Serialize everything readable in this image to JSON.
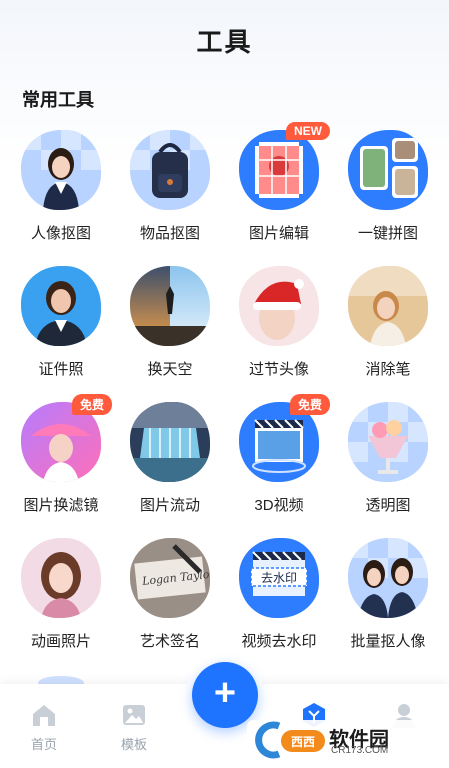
{
  "header": {
    "title": "工具"
  },
  "section": {
    "title": "常用工具"
  },
  "tools": [
    {
      "label": "人像抠图",
      "badge": ""
    },
    {
      "label": "物品抠图",
      "badge": ""
    },
    {
      "label": "图片编辑",
      "badge": "NEW"
    },
    {
      "label": "一键拼图",
      "badge": ""
    },
    {
      "label": "证件照",
      "badge": ""
    },
    {
      "label": "换天空",
      "badge": ""
    },
    {
      "label": "过节头像",
      "badge": ""
    },
    {
      "label": "消除笔",
      "badge": ""
    },
    {
      "label": "图片换滤镜",
      "badge": "免费"
    },
    {
      "label": "图片流动",
      "badge": ""
    },
    {
      "label": "3D视频",
      "badge": "免费"
    },
    {
      "label": "透明图",
      "badge": ""
    },
    {
      "label": "动画照片",
      "badge": ""
    },
    {
      "label": "艺术签名",
      "badge": ""
    },
    {
      "label": "视频去水印",
      "badge": ""
    },
    {
      "label": "批量抠人像",
      "badge": ""
    }
  ],
  "tool_images": {
    "art_signature_text": "Logan Taylor",
    "watermark_removal_text": "去水印"
  },
  "tabbar": {
    "home_label": "首页",
    "templates_label": "模板",
    "add_symbol": "+",
    "tools_label": "",
    "profile_label": ""
  },
  "watermark": {
    "brand": "软件园",
    "domain": "CR173.COM"
  },
  "colors": {
    "accent": "#1e73ff",
    "badge": "#ff5a3c"
  }
}
